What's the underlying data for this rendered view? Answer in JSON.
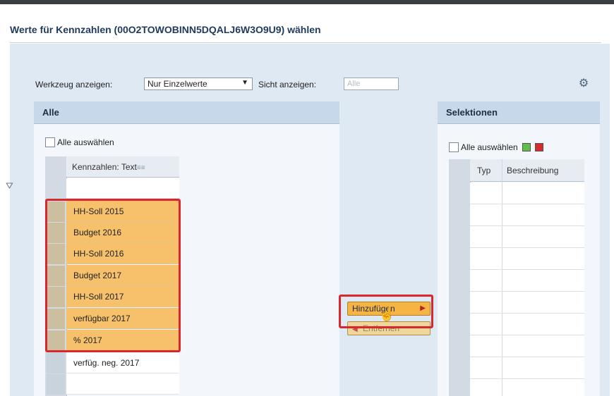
{
  "dialog": {
    "title": "Werte für Kennzahlen (00O2TOWOBINN5DQALJ6W3O9U9) wählen"
  },
  "toolbar": {
    "tool_label": "Werkzeug anzeigen:",
    "tool_select_value": "Nur Einzelwerte",
    "view_label": "Sicht anzeigen:",
    "view_value": "Alle",
    "settings_icon": "settings-icon"
  },
  "left_panel": {
    "header": "Alle",
    "select_all_label": "Alle auswählen",
    "column_header": "Kennzahlen: Text",
    "sort_marker": "≡≡",
    "filter_icon": "filter-icon",
    "rows": [
      {
        "text": "HH-Soll 2015",
        "selected": true
      },
      {
        "text": "Budget 2016",
        "selected": true
      },
      {
        "text": "HH-Soll 2016",
        "selected": true
      },
      {
        "text": "Budget 2017",
        "selected": true
      },
      {
        "text": "HH-Soll 2017",
        "selected": true
      },
      {
        "text": "verfügbar 2017",
        "selected": true
      },
      {
        "text": "% 2017",
        "selected": true
      },
      {
        "text": "verfüg. neg. 2017",
        "selected": false
      }
    ]
  },
  "actions": {
    "add_label": "Hinzufügen",
    "remove_label": "Entfernen",
    "add_arrow": "▶",
    "remove_arrow": "◀"
  },
  "right_panel": {
    "header": "Selektionen",
    "select_all_label": "Alle auswählen",
    "col_type": "Typ",
    "col_description": "Beschreibung",
    "include_color": "#5fbf4a",
    "exclude_color": "#d62b2b"
  },
  "colors": {
    "selected_row": "#f6c16a",
    "highlight_border": "#d9272e",
    "panel_header": "#c6d8ea"
  }
}
